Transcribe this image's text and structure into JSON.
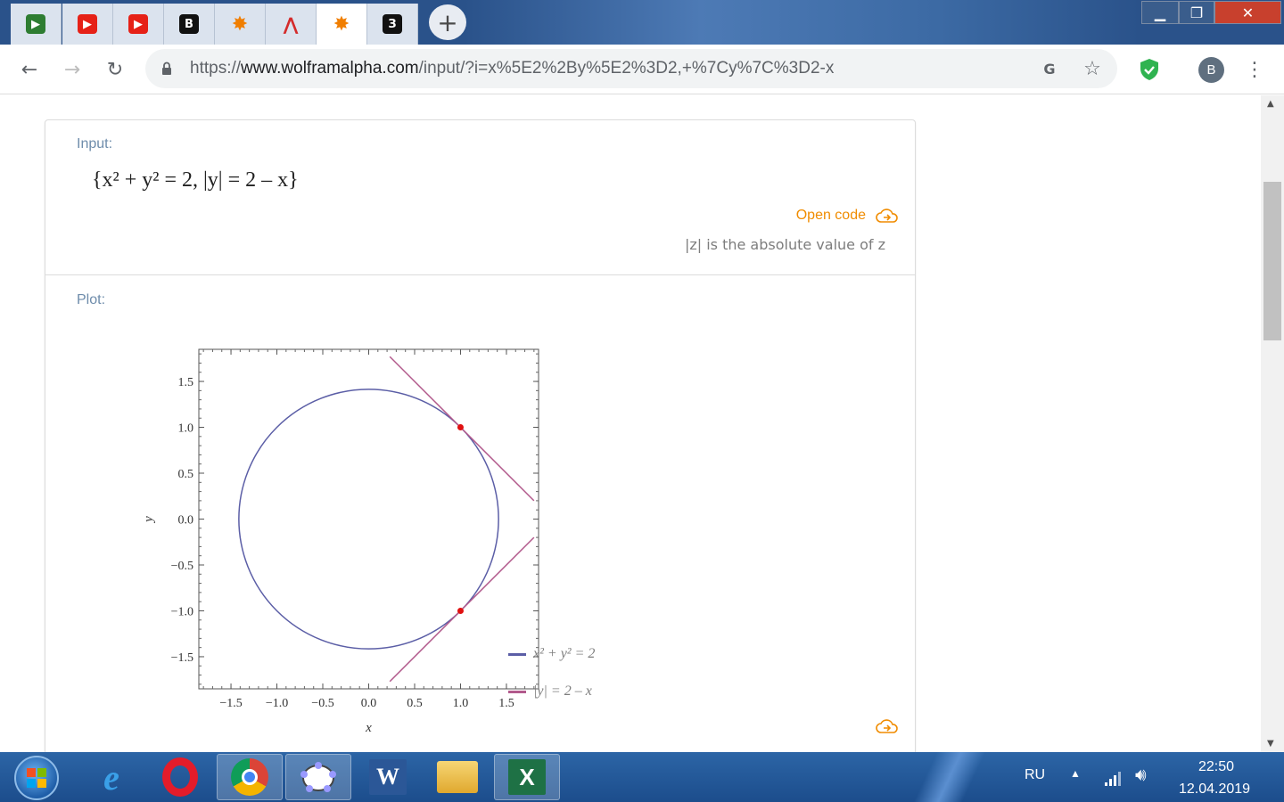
{
  "window": {
    "minimize_icon": "minimize-icon",
    "restore_icon": "restore-icon",
    "close_icon": "close-icon"
  },
  "tabs": [
    {
      "icon": "green-play-icon",
      "color": "#2e7d32"
    },
    {
      "icon": "youtube-icon",
      "color": "#e62117"
    },
    {
      "icon": "youtube-icon",
      "color": "#e62117"
    },
    {
      "icon": "b-logo-icon",
      "color": "#111111",
      "glyph": "B"
    },
    {
      "icon": "wolfram-star-icon",
      "color": "#f07e00"
    },
    {
      "icon": "bell-curve-icon",
      "color": "#d42b2b"
    },
    {
      "icon": "wolfram-star-icon",
      "color": "#f07e00",
      "active": true
    },
    {
      "icon": "z-logo-icon",
      "color": "#111111",
      "glyph": "З"
    }
  ],
  "address": {
    "scheme": "https://",
    "host": "www.wolframalpha.com",
    "path": "/input/?i=x%5E2%2By%5E2%3D2,+%7Cy%7C%3D2-x"
  },
  "profile_initial": "B",
  "pods": {
    "input_label": "Input:",
    "input_expr": "{x² + y² = 2, |y| = 2 – x}",
    "open_code": "Open code",
    "abs_note": "|z| is the absolute value of z",
    "plot_label": "Plot:"
  },
  "chart_data": {
    "type": "line",
    "xlabel": "x",
    "ylabel": "y",
    "xlim": [
      -1.85,
      1.85
    ],
    "ylim": [
      -1.85,
      1.85
    ],
    "xticks": [
      "−1.5",
      "−1.0",
      "−0.5",
      "0.0",
      "0.5",
      "1.0",
      "1.5"
    ],
    "yticks": [
      "1.5",
      "1.0",
      "0.5",
      "0.0",
      "−0.5",
      "−1.0",
      "−1.5"
    ],
    "series": [
      {
        "name": "x² + y² = 2",
        "kind": "circle",
        "center": [
          0,
          0
        ],
        "radius": 1.41421,
        "color": "#5b5ea6"
      },
      {
        "name": "|y| = 2 – x",
        "kind": "piecewise",
        "segments": [
          [
            [
              0.23,
              1.77
            ],
            [
              1.8,
              0.2
            ]
          ],
          [
            [
              0.23,
              -1.77
            ],
            [
              1.8,
              -0.2
            ]
          ]
        ],
        "color": "#b25a8c"
      }
    ],
    "points": [
      [
        1,
        1
      ],
      [
        1,
        -1
      ]
    ],
    "point_color": "#e01010",
    "legend_position": "bottom-right"
  },
  "taskbar": {
    "lang": "RU",
    "time": "22:50",
    "date": "12.04.2019"
  }
}
